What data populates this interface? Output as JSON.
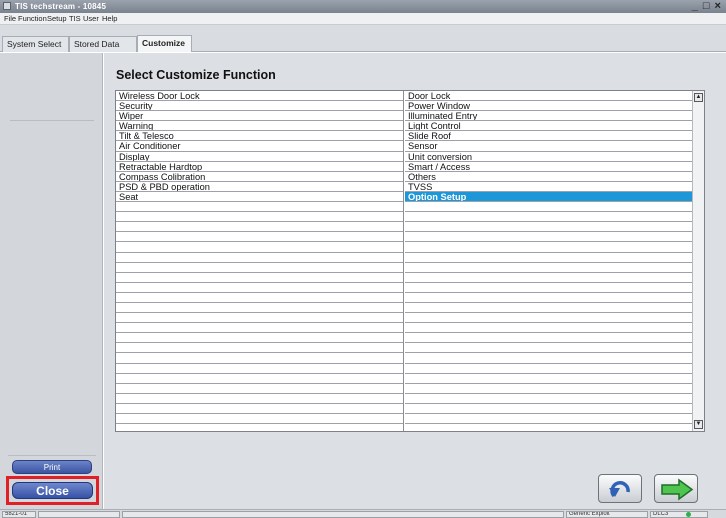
{
  "window": {
    "title": "TIS techstream - 10845",
    "controls": "_ □ ×"
  },
  "menu": [
    "File",
    "Function",
    "Setup",
    "TIS",
    "User",
    "Help"
  ],
  "tabs": [
    {
      "label": "System Select",
      "active": false
    },
    {
      "label": "Stored Data",
      "active": false
    },
    {
      "label": "Customize",
      "active": true
    }
  ],
  "sidebar": {
    "print_label": "Print",
    "close_label": "Close"
  },
  "main": {
    "heading": "Select Customize Function",
    "column_a": [
      "Wireless Door Lock",
      "Security",
      "Wiper",
      "Warning",
      "Tilt & Telesco",
      "Air Conditioner",
      "Display",
      "Retractable Hardtop",
      "Compass Colibration",
      "PSD & PBD operation",
      "Seat"
    ],
    "column_b": [
      "Door Lock",
      "Power Window",
      "Illuminated Entry",
      "Light Control",
      "Slide Roof",
      "Sensor",
      "Unit conversion",
      "Smart / Access",
      "Others",
      "TVSS",
      "Option Setup"
    ],
    "selected_item": "Option Setup",
    "empty_rows": 22,
    "selected_color": "#1e97d8"
  },
  "nav": {
    "back_icon": "undo-arrow-icon",
    "next_icon": "right-arrow-icon"
  },
  "status": {
    "left": "5821-01",
    "generic": "Generic Exploit",
    "conn": "DLC3"
  }
}
